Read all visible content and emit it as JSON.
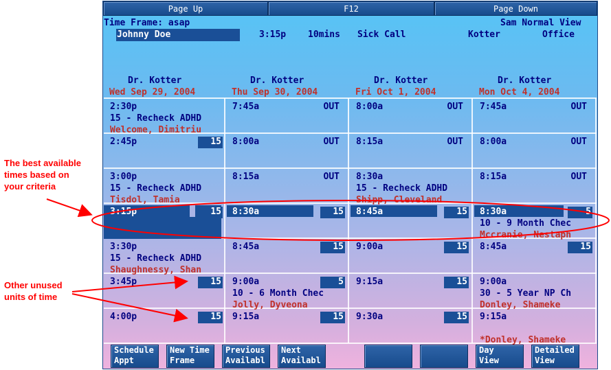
{
  "top_buttons": [
    "Page Up",
    "F12",
    "Page Down"
  ],
  "header": {
    "time_frame": "Time Frame: asap",
    "view_name": "Sam Normal View",
    "patient": "Johnny Doe",
    "time": "3:15p",
    "duration": "10mins",
    "reason": "Sick Call",
    "provider": "Kotter",
    "location": "Office"
  },
  "columns": [
    {
      "doctor": "Dr. Kotter",
      "date": "Wed Sep 29, 2004"
    },
    {
      "doctor": "Dr. Kotter",
      "date": "Thu Sep 30, 2004"
    },
    {
      "doctor": "Dr. Kotter",
      "date": "Fri Oct  1, 2004"
    },
    {
      "doctor": "Dr. Kotter",
      "date": "Mon Oct  4, 2004"
    }
  ],
  "rows": [
    [
      {
        "time": "2:30p",
        "appt": "15 - Recheck ADHD",
        "patient": "Welcome, Dimitriu"
      },
      {
        "time": "7:45a",
        "tag": "OUT"
      },
      {
        "time": "8:00a",
        "tag": "OUT"
      },
      {
        "time": "7:45a",
        "tag": "OUT"
      }
    ],
    [
      {
        "time": "2:45p",
        "units": "15"
      },
      {
        "time": "8:00a",
        "tag": "OUT"
      },
      {
        "time": "8:15a",
        "tag": "OUT"
      },
      {
        "time": "8:00a",
        "tag": "OUT"
      }
    ],
    [
      {
        "time": "3:00p",
        "appt": "15 - Recheck ADHD",
        "patient": "Tisdol, Tamia"
      },
      {
        "time": "8:15a",
        "tag": "OUT"
      },
      {
        "time": "8:30a",
        "appt": "15 - Recheck ADHD",
        "patient": "Shipp, Cleveland"
      },
      {
        "time": "8:15a",
        "tag": "OUT"
      }
    ],
    [
      {
        "time": "3:15p",
        "units": "15",
        "best": true
      },
      {
        "time": "8:30a",
        "units": "15",
        "best": true
      },
      {
        "time": "8:45a",
        "units": "15",
        "best": true
      },
      {
        "time": "8:30a",
        "units": "5",
        "best": true,
        "appt": "10 - 9 Month Chec",
        "patient": "Mccranie, Nestaph"
      }
    ],
    [
      {
        "time": "3:30p",
        "appt": "15 - Recheck ADHD",
        "patient": "Shaughnessy, Shan"
      },
      {
        "time": "8:45a",
        "units": "15"
      },
      {
        "time": "9:00a",
        "units": "15"
      },
      {
        "time": "8:45a",
        "units": "15"
      }
    ],
    [
      {
        "time": "3:45p",
        "units": "15"
      },
      {
        "time": "9:00a",
        "units": "5",
        "appt": "10 - 6 Month Chec",
        "patient": "Jolly, Dyveona"
      },
      {
        "time": "9:15a",
        "units": "15"
      },
      {
        "time": "9:00a",
        "appt": "30 - 5 Year NP Ch",
        "patient": "Donley, Shameke"
      }
    ],
    [
      {
        "time": "4:00p",
        "units": "15"
      },
      {
        "time": "9:15a",
        "units": "15"
      },
      {
        "time": "9:30a",
        "units": "15"
      },
      {
        "time": "9:15a",
        "patient": "*Donley, Shameke"
      }
    ]
  ],
  "function_keys": [
    [
      "Schedule",
      "Appt"
    ],
    [
      "New Time",
      "Frame"
    ],
    [
      "Previous",
      "Availabl"
    ],
    [
      "Next",
      "Availabl"
    ],
    [
      "",
      ""
    ],
    [
      "",
      ""
    ],
    [
      "Day",
      "View"
    ],
    [
      "Detailed",
      "View"
    ]
  ],
  "annotations": {
    "best_times": [
      "The best available",
      "times based on",
      "your criteria"
    ],
    "unused_units": [
      "Other unused",
      "units of time"
    ]
  },
  "colors": {
    "accent": "#1a4f97",
    "date_red": "#c0312b",
    "text_navy": "#000080",
    "annotation_red": "#ff0000"
  }
}
